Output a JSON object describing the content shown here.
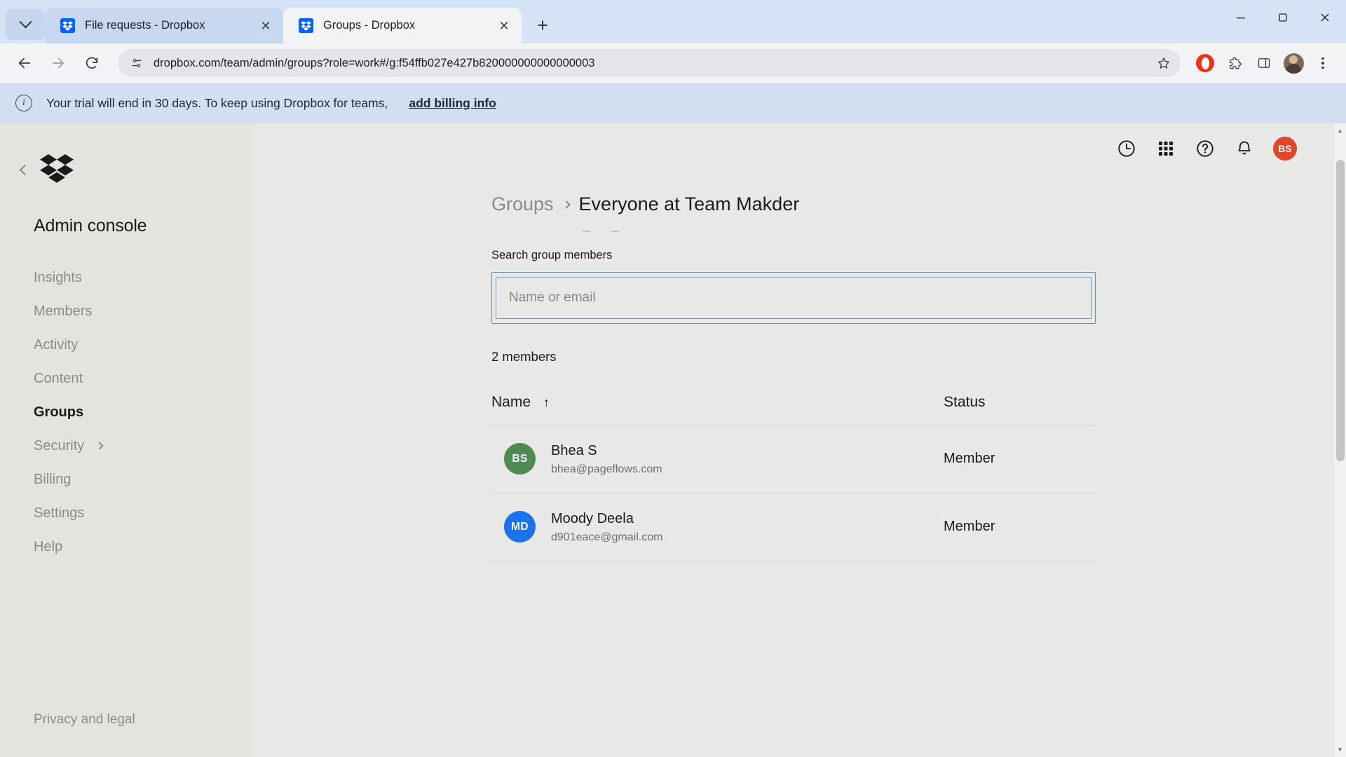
{
  "browser": {
    "tabs": [
      {
        "title": "File requests - Dropbox",
        "active": false,
        "favicon": "dropbox-icon"
      },
      {
        "title": "Groups - Dropbox",
        "active": true,
        "favicon": "dropbox-icon"
      }
    ],
    "new_tab_label": "+",
    "tab_list_icon": "chevron-down-icon",
    "window_controls": {
      "minimize": "—",
      "maximize": "☐",
      "close": "✕"
    },
    "nav": {
      "back": "←",
      "forward": "→",
      "reload": "⟳"
    },
    "omnibox": {
      "url": "dropbox.com/team/admin/groups?role=work#/g:f54ffb027e427b820000000000000003",
      "site_info_icon": "site-settings-icon",
      "bookmark_icon": "star-icon"
    },
    "toolbar_icons": [
      "opera-icon",
      "extensions-icon",
      "side-panel-icon",
      "profile-avatar",
      "kebab-menu-icon"
    ]
  },
  "banner": {
    "icon": "info-icon",
    "text": "Your trial will end in 30 days. To keep using Dropbox for teams,",
    "link": "add billing info"
  },
  "sidebar": {
    "logo": "dropbox-logo",
    "collapse_icon": "chevron-left-icon",
    "title": "Admin console",
    "items": [
      {
        "label": "Insights",
        "active": false,
        "chevron": false
      },
      {
        "label": "Members",
        "active": false,
        "chevron": false
      },
      {
        "label": "Activity",
        "active": false,
        "chevron": false
      },
      {
        "label": "Content",
        "active": false,
        "chevron": false
      },
      {
        "label": "Groups",
        "active": true,
        "chevron": false
      },
      {
        "label": "Security",
        "active": false,
        "chevron": true
      },
      {
        "label": "Billing",
        "active": false,
        "chevron": false
      },
      {
        "label": "Settings",
        "active": false,
        "chevron": false
      },
      {
        "label": "Help",
        "active": false,
        "chevron": false
      }
    ],
    "footer": "Privacy and legal"
  },
  "topbar": {
    "icons": [
      "clock-icon",
      "apps-grid-icon",
      "help-icon",
      "bell-icon"
    ],
    "avatar_initials": "BS",
    "avatar_color": "#e0462a"
  },
  "breadcrumb": {
    "parent": "Groups",
    "separator": "chevron-right-icon",
    "current": "Everyone at Team Makder"
  },
  "search": {
    "label": "Search group members",
    "placeholder": "Name or email",
    "value": ""
  },
  "members_count": "2 members",
  "table": {
    "columns": [
      {
        "key": "name",
        "label": "Name",
        "sort": "ascending",
        "sort_icon": "↑"
      },
      {
        "key": "status",
        "label": "Status"
      }
    ],
    "rows": [
      {
        "initials": "BS",
        "avatar_color": "#4e8a52",
        "name": "Bhea S",
        "email": "bhea@pageflows.com",
        "status": "Member"
      },
      {
        "initials": "MD",
        "avatar_color": "#1a73e8",
        "name": "Moody Deela",
        "email": "d901eace@gmail.com",
        "status": "Member"
      }
    ]
  }
}
